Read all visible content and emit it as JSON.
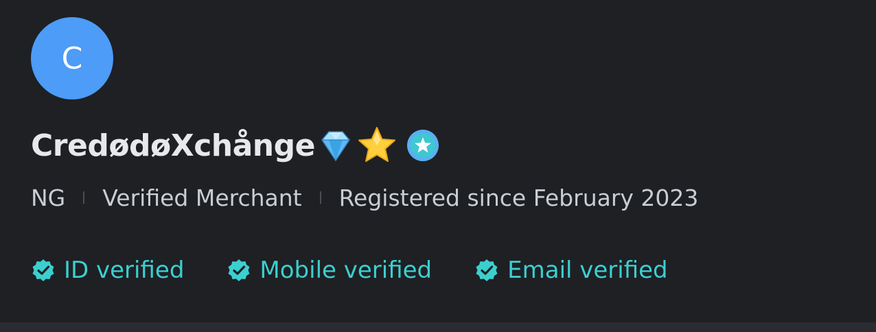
{
  "profile": {
    "avatar_initial": "C",
    "name": "CredødøXchånge",
    "badges": [
      "diamond-icon",
      "star-icon",
      "verified-star-badge-icon"
    ],
    "country": "NG",
    "merchant_status": "Verified Merchant",
    "registered": "Registered since February 2023"
  },
  "verifications": [
    {
      "label": "ID verified",
      "icon": "verified-check-icon"
    },
    {
      "label": "Mobile verified",
      "icon": "verified-check-icon"
    },
    {
      "label": "Email verified",
      "icon": "verified-check-icon"
    }
  ],
  "colors": {
    "background": "#1e2024",
    "avatar": "#4c9cf8",
    "verified_accent": "#3ccfcf",
    "primary_text": "#e6e8ec",
    "secondary_text": "#c9cdd4"
  }
}
